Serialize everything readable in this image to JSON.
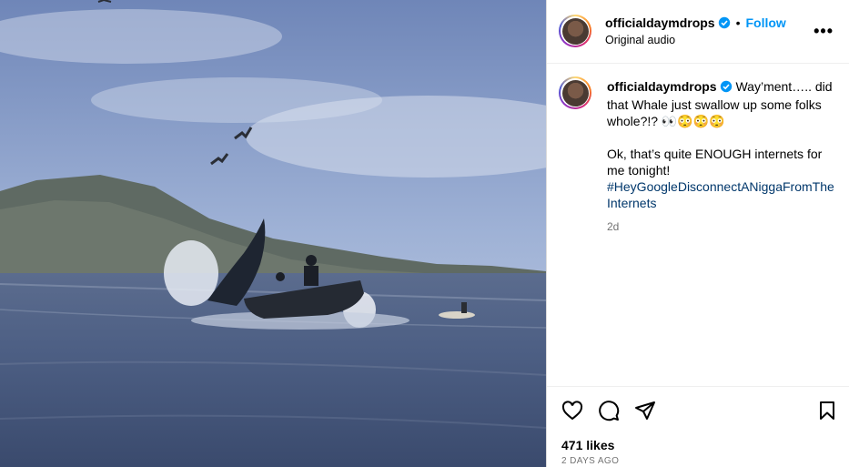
{
  "post": {
    "username": "officialdaymdrops",
    "follow_label": "Follow",
    "separator": "•",
    "audio": "Original audio",
    "more_label": "•••"
  },
  "caption": {
    "username": "officialdaymdrops",
    "line1": "Way’ment….. did that Whale just swallow up some folks whole?!? 👀😳😳😳",
    "line2": "Ok, that’s quite ENOUGH internets for me tonight!",
    "hashtag": "#HeyGoogleDisconnectANiggaFromTheInternets",
    "age": "2d"
  },
  "footer": {
    "likes": "471 likes",
    "timestamp": "2 DAYS AGO"
  },
  "icons": {
    "verified": "verified-badge-icon",
    "like": "heart-icon",
    "comment": "comment-icon",
    "share": "send-icon",
    "save": "bookmark-icon"
  },
  "colors": {
    "accent": "#0095f6",
    "hashtag": "#00376b",
    "muted": "#737373"
  }
}
